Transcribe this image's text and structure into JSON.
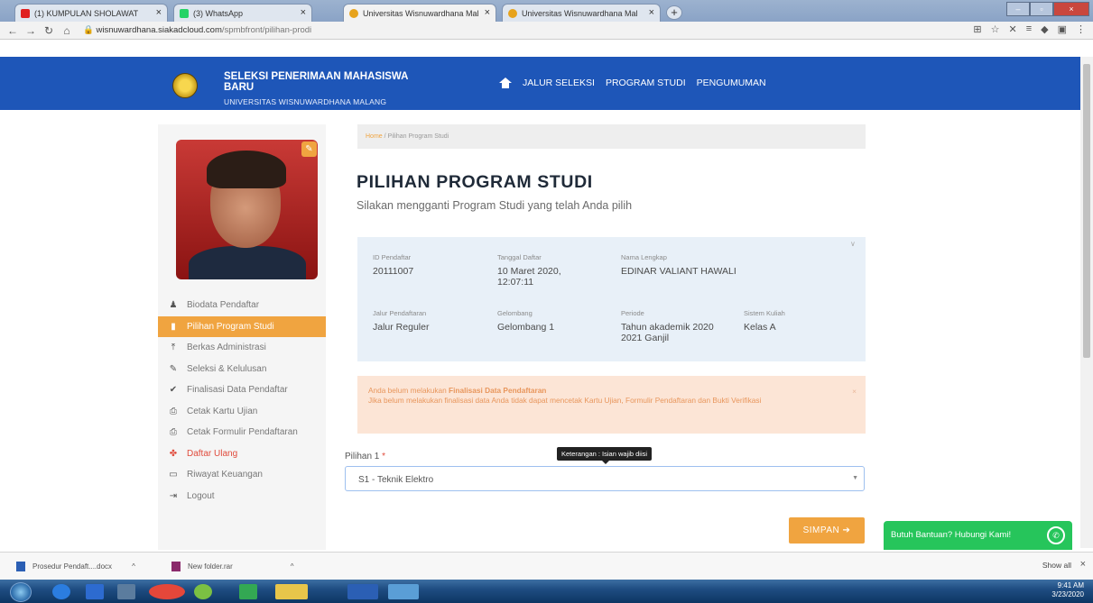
{
  "browser": {
    "tabs": [
      {
        "label": "(1) KUMPULAN SHOLAWAT",
        "color": "#e02020"
      },
      {
        "label": "(3) WhatsApp",
        "color": "#25d366"
      },
      {
        "label": "Universitas Wisnuwardhana Mal",
        "color": "#e7a31c"
      },
      {
        "label": "Universitas Wisnuwardhana Mal",
        "color": "#e7a31c"
      }
    ],
    "url_host": "wisnuwardhana.siakadcloud.com",
    "url_path": "/spmbfront/pilihan-prodi"
  },
  "header": {
    "title": "SELEKSI PENERIMAAN MAHASISWA BARU",
    "subtitle": "UNIVERSITAS WISNUWARDHANA MALANG",
    "nav": [
      "JALUR SELEKSI",
      "PROGRAM STUDI",
      "PENGUMUMAN"
    ],
    "color": "#1e56b8"
  },
  "sidebar": {
    "items": [
      {
        "label": "Biodata Pendaftar",
        "icon": "user-icon"
      },
      {
        "label": "Pilihan Program Studi",
        "icon": "bookmark-icon"
      },
      {
        "label": "Berkas Administrasi",
        "icon": "upload-icon"
      },
      {
        "label": "Seleksi & Kelulusan",
        "icon": "edit-icon"
      },
      {
        "label": "Finalisasi Data Pendaftar",
        "icon": "check-icon"
      },
      {
        "label": "Cetak Kartu Ujian",
        "icon": "print-icon"
      },
      {
        "label": "Cetak Formulir Pendaftaran",
        "icon": "print-icon"
      },
      {
        "label": "Daftar Ulang",
        "icon": "register-icon"
      },
      {
        "label": "Riwayat Keuangan",
        "icon": "money-icon"
      },
      {
        "label": "Logout",
        "icon": "logout-icon"
      }
    ],
    "accent": "#f0a440"
  },
  "main": {
    "breadcrumb_home": "Home",
    "breadcrumb_current": "/ Pilihan Program Studi",
    "title": "PILIHAN PROGRAM STUDI",
    "subtitle": "Silakan mengganti Program Studi yang telah Anda pilih",
    "info": {
      "id_label": "ID Pendaftar",
      "id_value": "20111007",
      "date_label": "Tanggal Daftar",
      "date_value": "10 Maret 2020,",
      "time_value": "12:07:11",
      "name_label": "Nama Lengkap",
      "name_value": "EDINAR VALIANT HAWALI",
      "jalur_label": "Jalur Pendaftaran",
      "jalur_value": "Jalur Reguler",
      "gel_label": "Gelombang",
      "gel_value": "Gelombang 1",
      "periode_label": "Periode",
      "periode_value": "Tahun akademik 2020",
      "periode_value2": "2021 Ganjil",
      "sistem_label": "Sistem Kuliah",
      "sistem_value": "Kelas A"
    },
    "alert": {
      "prefix": "Anda belum melakukan ",
      "bold": "Finalisasi Data Pendaftaran",
      "body": "Jika belum melakukan finalisasi data Anda tidak dapat mencetak Kartu Ujian, Formulir Pendaftaran dan Bukti Verifikasi"
    },
    "choice_label": "Pilihan 1",
    "required_mark": "*",
    "tooltip": "Keterangan : Isian wajib diisi",
    "choice_value": "S1 - Teknik Elektro",
    "save_label": "SIMPAN",
    "help_label": "Butuh Bantuan? Hubungi Kami!"
  },
  "downloads": {
    "items": [
      "Prosedur Pendaft....docx",
      "New folder.rar"
    ],
    "show_all": "Show all"
  },
  "tray": {
    "time": "9:41 AM",
    "date": "3/23/2020"
  }
}
